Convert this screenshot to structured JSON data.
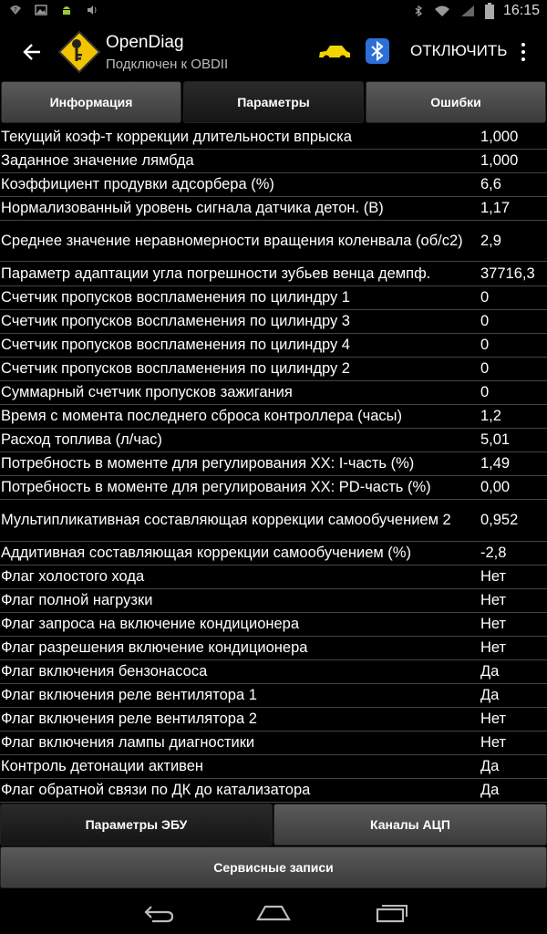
{
  "status_bar": {
    "time": "16:15",
    "icons": [
      "wifi-question-icon",
      "image-icon",
      "android-icon",
      "volume-icon",
      "bluetooth-icon",
      "wifi-icon",
      "signal-icon",
      "battery-icon"
    ]
  },
  "action_bar": {
    "title": "OpenDiag",
    "subtitle": "Подключен к OBDII",
    "disconnect_label": "ОТКЛЮЧИТЬ",
    "car_color": "#f2d500",
    "bluetooth_color": "#2d6fd8"
  },
  "tabs": [
    {
      "label": "Информация",
      "active": false
    },
    {
      "label": "Параметры",
      "active": true
    },
    {
      "label": "Ошибки",
      "active": false
    }
  ],
  "parameters": [
    {
      "name": "Текущий коэф-т коррекции длительности впрыска",
      "value": "1,000"
    },
    {
      "name": "Заданное значение лямбда",
      "value": "1,000"
    },
    {
      "name": "Коэффициент продувки адсорбера (%)",
      "value": "6,6"
    },
    {
      "name": "Нормализованный уровень сигнала датчика детон. (В)",
      "value": "1,17"
    },
    {
      "name": "Среднее значение неравномерности вращения коленвала (об/с2)",
      "value": "2,9"
    },
    {
      "name": "Параметр адаптации угла погрешности зубьев венца демпф.",
      "value": "37716,3"
    },
    {
      "name": "Счетчик пропусков воспламенения по цилиндру 1",
      "value": "0"
    },
    {
      "name": "Счетчик пропусков воспламенения по цилиндру 3",
      "value": "0"
    },
    {
      "name": "Счетчик пропусков воспламенения по цилиндру 4",
      "value": "0"
    },
    {
      "name": "Счетчик пропусков воспламенения по цилиндру 2",
      "value": "0"
    },
    {
      "name": "Суммарный счетчик пропусков зажигания",
      "value": "0"
    },
    {
      "name": "Время с момента последнего сброса контроллера (часы)",
      "value": "1,2"
    },
    {
      "name": "Расход топлива (л/час)",
      "value": "5,01"
    },
    {
      "name": "Потребность в моменте для регулирования ХХ: I-часть (%)",
      "value": "1,49"
    },
    {
      "name": "Потребность в моменте для регулирования ХХ: PD-часть (%)",
      "value": "0,00"
    },
    {
      "name": "Мультипликативная составляющая коррекции самообучением 2",
      "value": "0,952"
    },
    {
      "name": "Аддитивная составляющая коррекции самообучением (%)",
      "value": "-2,8"
    },
    {
      "name": "Флаг холостого хода",
      "value": "Нет"
    },
    {
      "name": "Флаг полной нагрузки",
      "value": "Нет"
    },
    {
      "name": "Флаг запроса на включение кондиционера",
      "value": "Нет"
    },
    {
      "name": "Флаг разрешения включение кондиционера",
      "value": "Нет"
    },
    {
      "name": "Флаг включения бензонасоса",
      "value": "Да"
    },
    {
      "name": "Флаг включения реле вентилятора 1",
      "value": "Да"
    },
    {
      "name": "Флаг включения реле вентилятора 2",
      "value": "Нет"
    },
    {
      "name": "Флаг включения лампы диагностики",
      "value": "Нет"
    },
    {
      "name": "Контроль детонации активен",
      "value": "Да"
    },
    {
      "name": "Флаг обратной связи по ДК до катализатора",
      "value": "Да"
    }
  ],
  "bottom_buttons": {
    "ecu_params": "Параметры ЭБУ",
    "adc_channels": "Каналы АЦП",
    "service_records": "Сервисные записи"
  }
}
